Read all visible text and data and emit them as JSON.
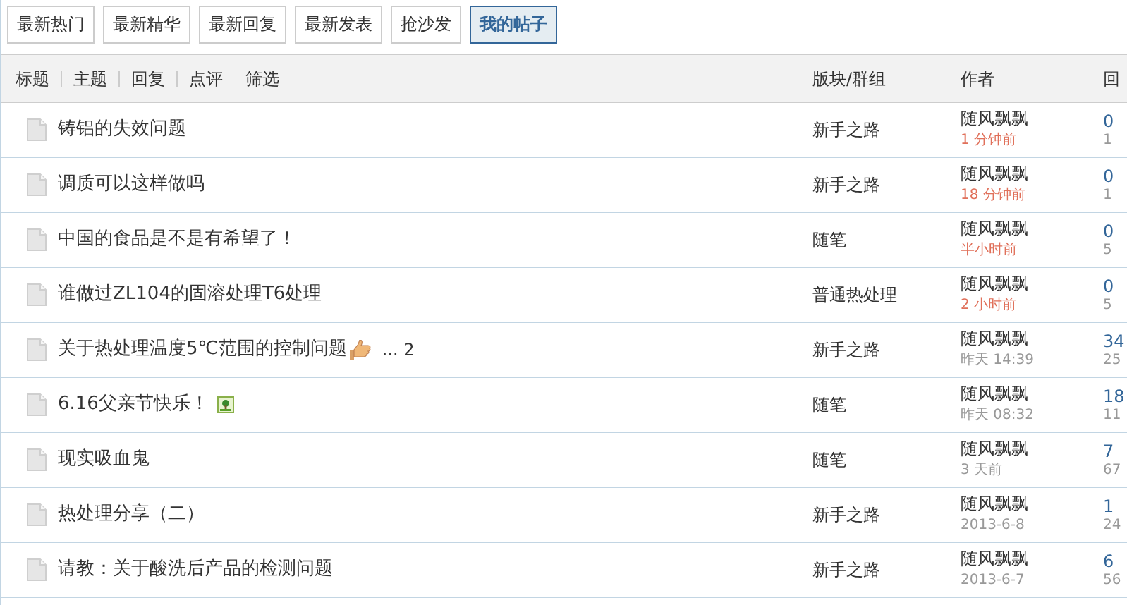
{
  "tabs": [
    {
      "label": "最新热门",
      "selected": false
    },
    {
      "label": "最新精华",
      "selected": false
    },
    {
      "label": "最新回复",
      "selected": false
    },
    {
      "label": "最新发表",
      "selected": false
    },
    {
      "label": "抢沙发",
      "selected": false
    },
    {
      "label": "我的帖子",
      "selected": true
    }
  ],
  "filters": [
    {
      "label": "标题",
      "divider": false
    },
    {
      "label": "主题",
      "divider": true
    },
    {
      "label": "回复",
      "divider": true
    },
    {
      "label": "点评",
      "divider": true
    },
    {
      "label": "筛选",
      "divider": false
    }
  ],
  "columns": [
    "版块/群组",
    "作者",
    "回"
  ],
  "rows": [
    {
      "title": "铸铝的失效问题",
      "forum": "新手之路",
      "author": "随风飘飘",
      "time": "1 分钟前",
      "recent": true,
      "replies": "0",
      "views": "1"
    },
    {
      "title": "调质可以这样做吗",
      "forum": "新手之路",
      "author": "随风飘飘",
      "time": "18 分钟前",
      "recent": true,
      "replies": "0",
      "views": "1"
    },
    {
      "title": "中国的食品是不是有希望了！",
      "forum": "随笔",
      "author": "随风飘飘",
      "time": "半小时前",
      "recent": true,
      "replies": "0",
      "views": "5"
    },
    {
      "title": "谁做过ZL104的固溶处理T6处理",
      "forum": "普通热处理",
      "author": "随风飘飘",
      "time": "2 小时前",
      "recent": true,
      "replies": "0",
      "views": "5"
    },
    {
      "title": "关于热处理温度5℃范围的控制问题",
      "icons": [
        {
          "kind": "thumb"
        }
      ],
      "pages": "... 2",
      "forum": "新手之路",
      "author": "随风飘飘",
      "time": "昨天 14:39",
      "recent": false,
      "replies": "34",
      "views": "25"
    },
    {
      "title": "6.16父亲节快乐！",
      "icons": [
        {
          "kind": "image"
        }
      ],
      "forum": "随笔",
      "author": "随风飘飘",
      "time": "昨天 08:32",
      "recent": false,
      "replies": "18",
      "views": "11"
    },
    {
      "title": "现实吸血鬼",
      "forum": "随笔",
      "author": "随风飘飘",
      "time": "3 天前",
      "recent": false,
      "replies": "7",
      "views": "67"
    },
    {
      "title": "热处理分享（二）",
      "forum": "新手之路",
      "author": "随风飘飘",
      "time": "2013-6-8",
      "recent": false,
      "replies": "1",
      "views": "24"
    },
    {
      "title": "请教：关于酸洗后产品的检测问题",
      "forum": "新手之路",
      "author": "随风飘飘",
      "time": "2013-6-7",
      "recent": false,
      "replies": "6",
      "views": "56"
    }
  ]
}
